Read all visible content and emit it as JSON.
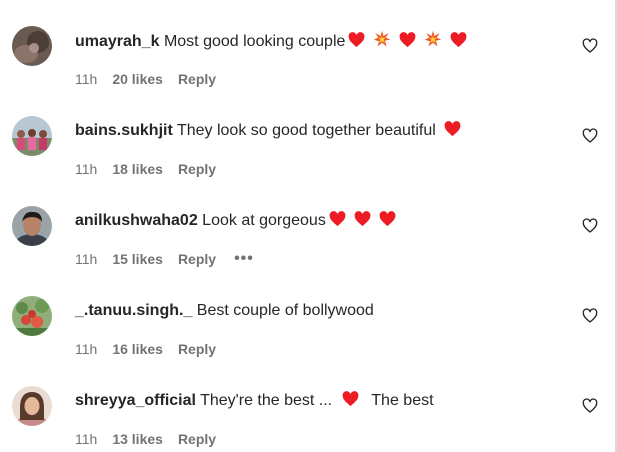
{
  "comments": [
    {
      "username": "umayrah_k",
      "text": "Most good looking couple",
      "emoji_after": [
        "red-heart",
        "collision",
        "red-heart",
        "collision",
        "red-heart"
      ],
      "time": "11h",
      "likes": "20 likes",
      "reply": "Reply",
      "avatar": "avatar-dark-photo"
    },
    {
      "username": "bains.sukhjit",
      "text": "They look so good together beautiful",
      "emoji_after": [
        "red-heart"
      ],
      "time": "11h",
      "likes": "18 likes",
      "reply": "Reply",
      "avatar": "avatar-group-photo"
    },
    {
      "username": "anilkushwaha02",
      "text": "Look at gorgeous",
      "emoji_after": [
        "red-heart",
        "red-heart",
        "red-heart"
      ],
      "time": "11h",
      "likes": "15 likes",
      "reply": "Reply",
      "more": "•••",
      "avatar": "avatar-man-photo"
    },
    {
      "username": "_.tanuu.singh._",
      "text": "Best couple of bollywood",
      "emoji_after": [],
      "time": "11h",
      "likes": "16 likes",
      "reply": "Reply",
      "avatar": "avatar-flowers-photo"
    },
    {
      "username": "shreyya_official",
      "text_before": "They're the best ...",
      "emoji_middle": [
        "red-heart"
      ],
      "text_after": "The best",
      "time": "11h",
      "likes": "13 likes",
      "reply": "Reply",
      "avatar": "avatar-woman-photo"
    }
  ],
  "icons": {
    "like": "heart-outline-icon",
    "heart_color": "#ed1c24",
    "collision_color": "#f05a28"
  },
  "colors": {
    "text": "#262626",
    "secondary": "#737373"
  }
}
